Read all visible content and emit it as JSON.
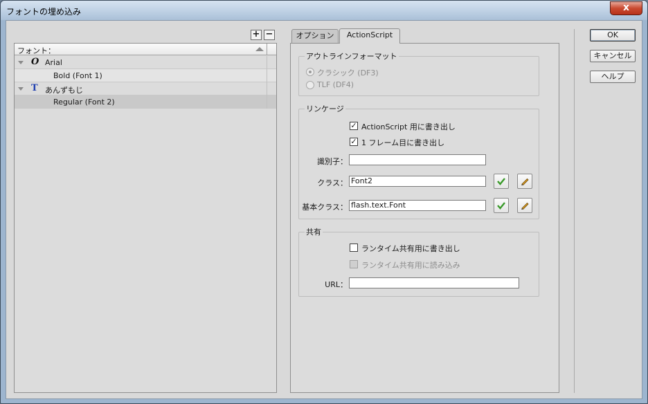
{
  "window": {
    "title": "フォントの埋め込み",
    "close_label": "x"
  },
  "left_panel": {
    "add_label": "+",
    "remove_label": "−",
    "header_label": "フォント：",
    "rows": [
      {
        "label": "Arial",
        "type": "family",
        "icon": "italic-o-font-icon"
      },
      {
        "label": "Bold (Font 1)",
        "type": "style"
      },
      {
        "label": "あんずもじ",
        "type": "family",
        "icon": "truetype-font-icon"
      },
      {
        "label": "Regular (Font 2)",
        "type": "style",
        "selected": true
      }
    ]
  },
  "tabs": [
    {
      "label": "オプション",
      "active": false
    },
    {
      "label": "ActionScript",
      "active": true
    }
  ],
  "outline": {
    "title": "アウトラインフォーマット",
    "options": [
      {
        "label": "クラシック (DF3)",
        "checked": true,
        "disabled": true
      },
      {
        "label": "TLF (DF4)",
        "checked": false,
        "disabled": true
      }
    ]
  },
  "linkage": {
    "title": "リンケージ",
    "export_as": {
      "label": "ActionScript 用に書き出し",
      "checked": true
    },
    "export_frame1": {
      "label": "1 フレーム目に書き出し",
      "checked": true
    },
    "identifier": {
      "label": "識別子：",
      "value": ""
    },
    "class": {
      "label": "クラス：",
      "value": "Font2"
    },
    "base_class": {
      "label": "基本クラス：",
      "value": "flash.text.Font"
    }
  },
  "sharing": {
    "title": "共有",
    "export_runtime": {
      "label": "ランタイム共有用に書き出し",
      "checked": false
    },
    "import_runtime": {
      "label": "ランタイム共有用に読み込み",
      "checked": false,
      "disabled": true
    },
    "url": {
      "label": "URL：",
      "value": ""
    }
  },
  "buttons": {
    "ok": "OK",
    "cancel": "キャンセル",
    "help": "ヘルプ"
  }
}
